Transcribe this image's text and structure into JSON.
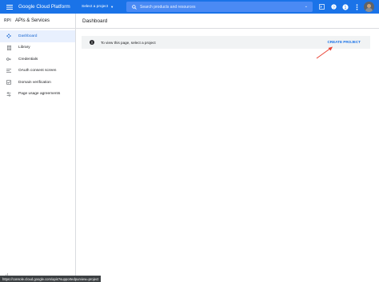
{
  "header": {
    "brand": "Google Cloud Platform",
    "project_selector": "Select a project",
    "search_placeholder": "Search products and resources",
    "brand_color": "#1a73e8"
  },
  "sidebar": {
    "logo": "RPI",
    "title": "APIs & Services",
    "items": [
      {
        "label": "Dashboard",
        "icon": "dashboard-icon",
        "active": true
      },
      {
        "label": "Library",
        "icon": "library-icon"
      },
      {
        "label": "Credentials",
        "icon": "key-icon"
      },
      {
        "label": "OAuth consent screen",
        "icon": "consent-icon"
      },
      {
        "label": "Domain verification",
        "icon": "checkbox-icon"
      },
      {
        "label": "Page usage agreements",
        "icon": "settings-icon"
      }
    ]
  },
  "main": {
    "title": "Dashboard",
    "banner": {
      "message": "To view this page, select a project",
      "action": "CREATE PROJECT"
    }
  },
  "status_url": "https://console.cloud.google.com/apis?supportedpurview=project",
  "colors": {
    "accent": "#1a73e8",
    "arrow": "#ea4335",
    "active_bg": "#e8f0fe"
  }
}
